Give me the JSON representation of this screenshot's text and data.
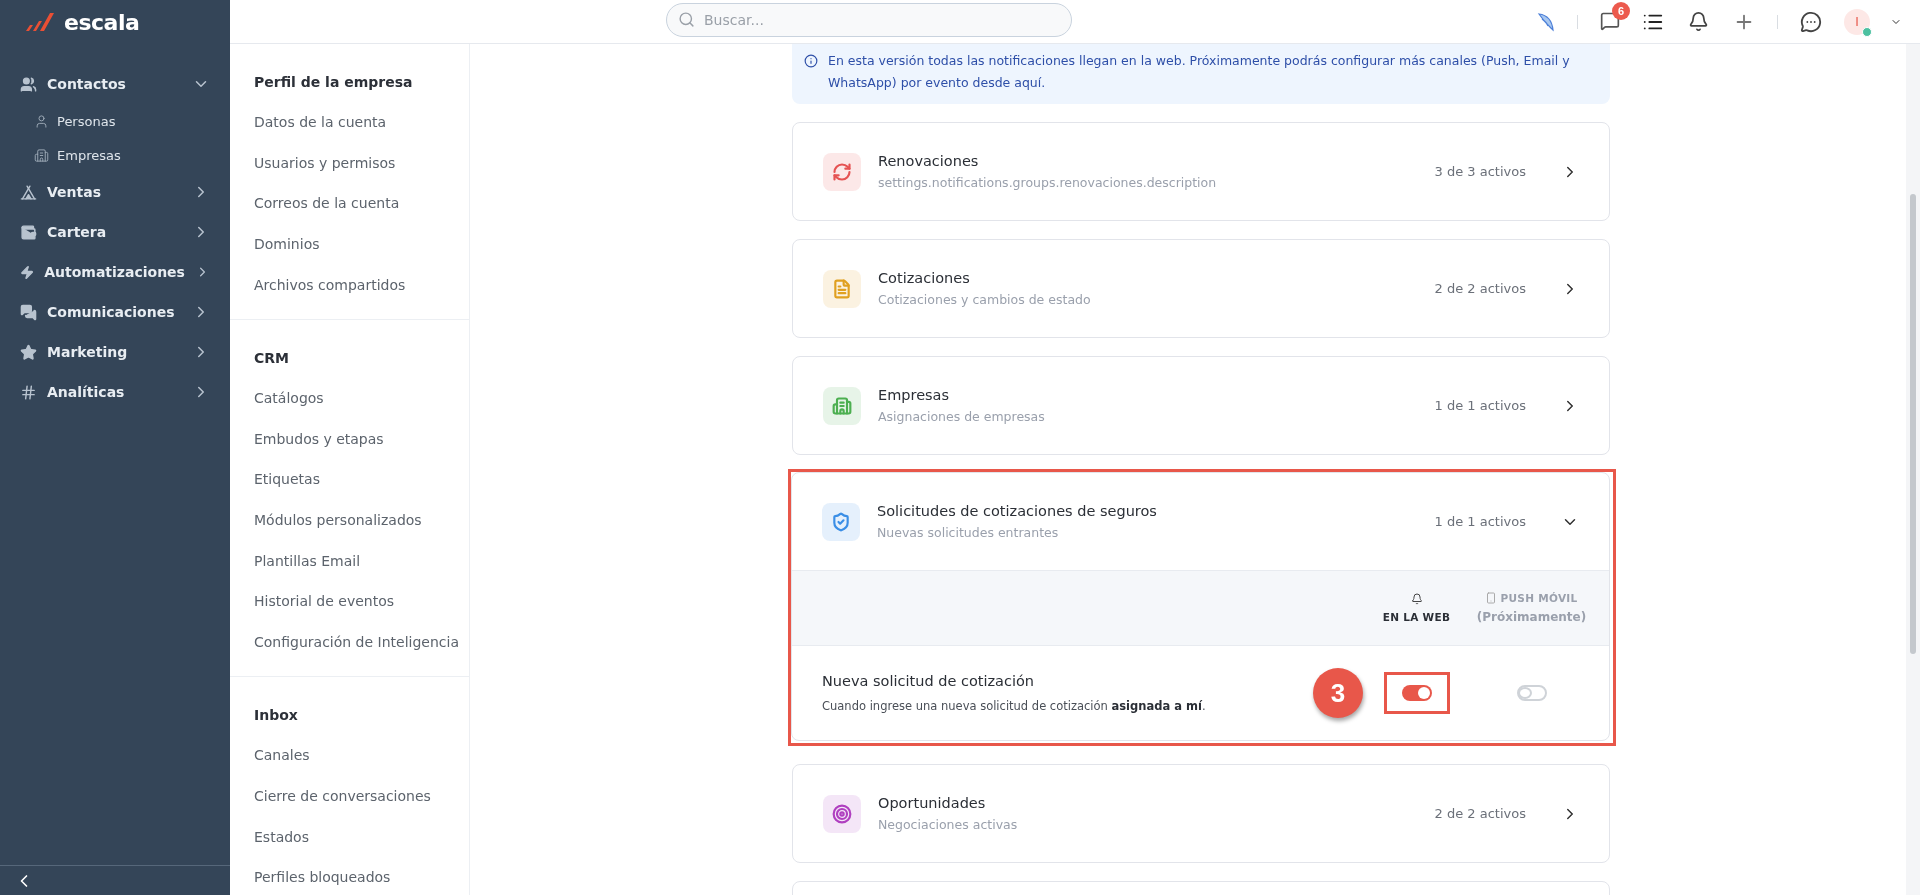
{
  "brand": {
    "name": "escala"
  },
  "sidebar": {
    "items": [
      {
        "label": "Contactos",
        "expanded": true,
        "children": [
          {
            "label": "Personas"
          },
          {
            "label": "Empresas"
          }
        ]
      },
      {
        "label": "Ventas",
        "expanded": false
      },
      {
        "label": "Cartera",
        "expanded": false
      },
      {
        "label": "Automatizaciones",
        "expanded": false
      },
      {
        "label": "Comunicaciones",
        "expanded": false
      },
      {
        "label": "Marketing",
        "expanded": false
      },
      {
        "label": "Analíticas",
        "expanded": false
      }
    ]
  },
  "topbar": {
    "search": {
      "placeholder": "Buscar..."
    },
    "messages_badge": "6",
    "avatar_initial": "I"
  },
  "settings_nav": [
    {
      "title": "Perfil de la empresa",
      "items": [
        "Datos de la cuenta",
        "Usuarios y permisos",
        "Correos de la cuenta",
        "Dominios",
        "Archivos compartidos"
      ]
    },
    {
      "title": "CRM",
      "items": [
        "Catálogos",
        "Embudos y etapas",
        "Etiquetas",
        "Módulos personalizados",
        "Plantillas Email",
        "Historial de eventos",
        "Configuración de Inteligencia"
      ]
    },
    {
      "title": "Inbox",
      "items": [
        "Canales",
        "Cierre de conversaciones",
        "Estados",
        "Perfiles bloqueados"
      ]
    }
  ],
  "info_banner": "En esta versión todas las notificaciones llegan en la web. Próximamente podrás configurar más canales (Push, Email y WhatsApp) por evento desde aquí.",
  "groups": [
    {
      "title": "Renovaciones",
      "description": "settings.notifications.groups.renovaciones.description",
      "count": "3 de 3 activos",
      "color": "#e55353",
      "expanded": false
    },
    {
      "title": "Cotizaciones",
      "description": "Cotizaciones y cambios de estado",
      "count": "2 de 2 activos",
      "color": "#e0a020",
      "expanded": false
    },
    {
      "title": "Empresas",
      "description": "Asignaciones de empresas",
      "count": "1 de 1 activos",
      "color": "#4caf50",
      "expanded": false
    },
    {
      "title": "Solicitudes de cotizaciones de seguros",
      "description": "Nuevas solicitudes entrantes",
      "count": "1 de 1 activos",
      "color": "#3a8ee6",
      "expanded": true,
      "annotation": "3",
      "columns": [
        {
          "label": "EN LA WEB"
        },
        {
          "label": "PUSH MÓVIL",
          "note": "(Próximamente)"
        }
      ],
      "events": [
        {
          "title": "Nueva solicitud de cotización",
          "description": "Cuando ingrese una nueva solicitud de cotización **asignada a mí**.",
          "web_on": true,
          "push_on": false
        }
      ]
    },
    {
      "title": "Oportunidades",
      "description": "Negociaciones activas",
      "count": "2 de 2 activos",
      "color": "#b040c0",
      "expanded": false
    }
  ]
}
